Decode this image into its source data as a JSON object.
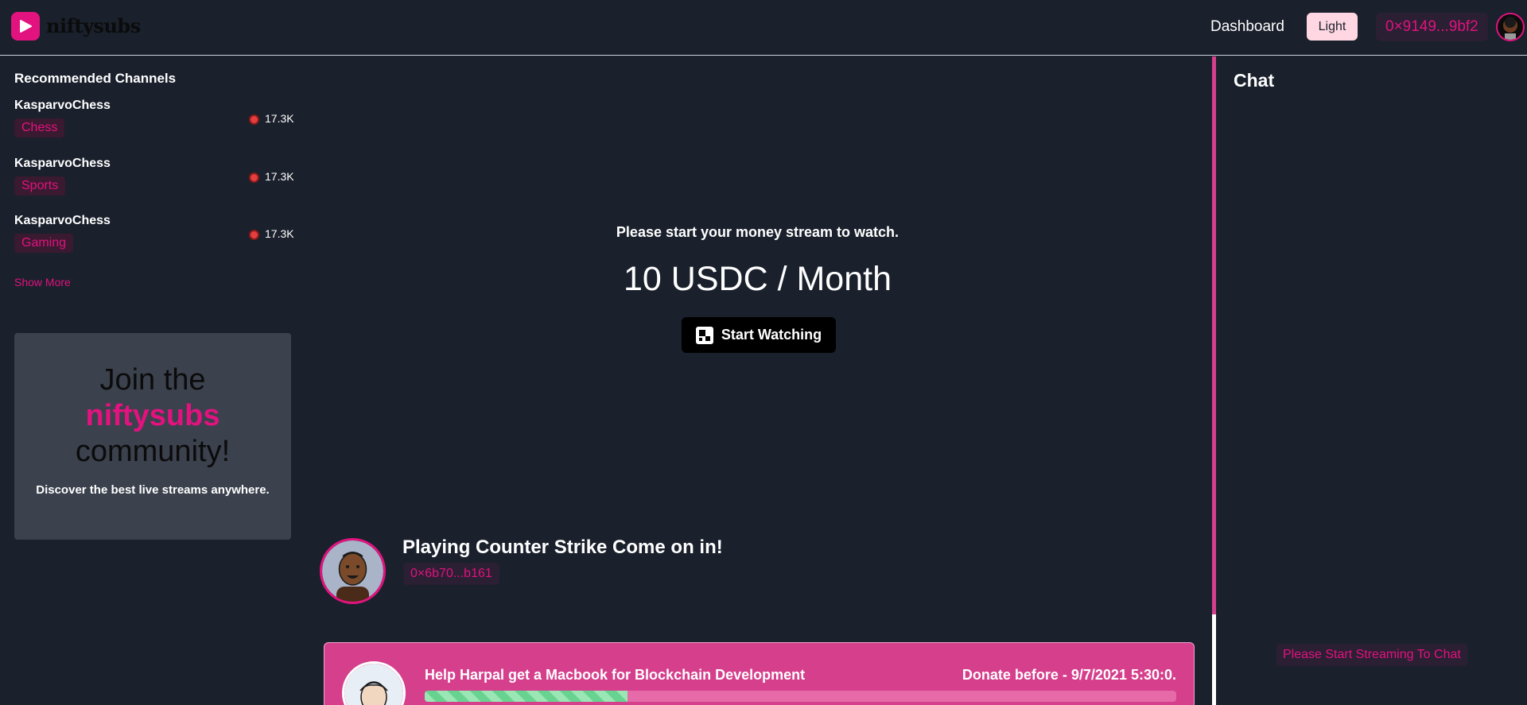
{
  "header": {
    "brand": "niftysubs",
    "nav_dashboard": "Dashboard",
    "theme_toggle": "Light",
    "wallet_address": "0×9149...9bf2",
    "accent_color": "#e2127f"
  },
  "sidebar": {
    "title": "Recommended Channels",
    "channels": [
      {
        "name": "KasparvoChess",
        "tag": "Chess",
        "viewers": "17.3K"
      },
      {
        "name": "KasparvoChess",
        "tag": "Sports",
        "viewers": "17.3K"
      },
      {
        "name": "KasparvoChess",
        "tag": "Gaming",
        "viewers": "17.3K"
      }
    ],
    "show_more": "Show More",
    "join_card": {
      "line1": "Join the",
      "line2": "niftysubs",
      "line3": "community!",
      "subtitle": "Discover the best live streams anywhere."
    }
  },
  "player": {
    "prompt": "Please start your money stream to watch.",
    "price": "10 USDC / Month",
    "start_button": "Start Watching"
  },
  "stream": {
    "title": "Playing Counter Strike Come on in!",
    "streamer_address": "0×6b70...b161"
  },
  "donation": {
    "title": "Help Harpal get a Macbook for Blockchain Development",
    "deadline": "Donate before - 9/7/2021 5:30:0.",
    "progress_fraction": 0.27
  },
  "chat": {
    "title": "Chat",
    "input_placeholder": "Please Start Streaming To Chat"
  }
}
